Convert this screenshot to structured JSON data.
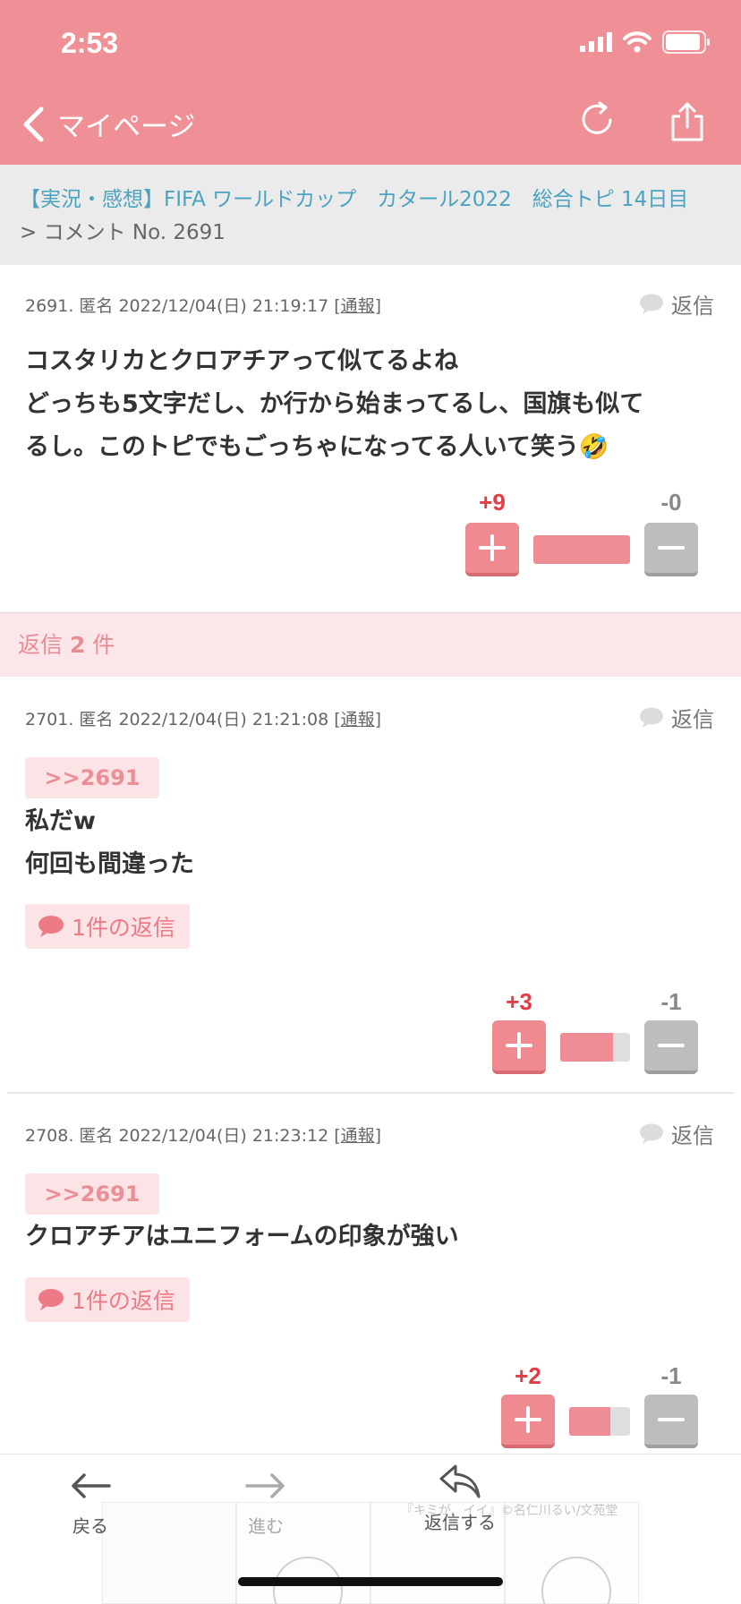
{
  "status_bar": {
    "time": "2:53"
  },
  "header": {
    "back_label": "マイページ"
  },
  "breadcrumb": {
    "topic": "【実況・感想】FIFA ワールドカップ　カタール2022　総合トピ 14日目",
    "comment": "> コメント No. 2691"
  },
  "main_comment": {
    "meta_prefix": "2691. 匿名 2022/12/04(日) 21:19:17 [",
    "report": "通報",
    "meta_suffix": "]",
    "reply_label": "返信",
    "lines": [
      "コスタリカとクロアチアって似てるよね",
      "どっちも5文字だし、か行から始まってるし、国旗も似て",
      "るし。このトピでもごっちゃになってる人いて笑う🤣"
    ],
    "plus": "+9",
    "minus": "-0",
    "ratio": 1.0
  },
  "replies_header": {
    "prefix": "返信 ",
    "count": "2",
    "suffix": " 件"
  },
  "replies": [
    {
      "meta_prefix": "2701. 匿名 2022/12/04(日) 21:21:08 [",
      "report": "通報",
      "meta_suffix": "]",
      "reply_label": "返信",
      "anchor": ">>2691",
      "lines": [
        "私だw",
        "何回も間違った"
      ],
      "reply_count": "1件の返信",
      "plus": "+3",
      "minus": "-1",
      "ratio": 0.75
    },
    {
      "meta_prefix": "2708. 匿名 2022/12/04(日) 21:23:12 [",
      "report": "通報",
      "meta_suffix": "]",
      "reply_label": "返信",
      "anchor": ">>2691",
      "lines": [
        "クロアチアはユニフォームの印象が強い"
      ],
      "reply_count": "1件の返信",
      "plus": "+2",
      "minus": "-1",
      "ratio": 0.67
    }
  ],
  "toolbar": {
    "back": "戻る",
    "forward": "進む",
    "reply": "返信する"
  },
  "ad": {
    "text": "『キミが、イイ』©名仁川るい/文苑堂"
  },
  "colors": {
    "header": "#ef9096",
    "accent": "#e23c44",
    "link": "#4aa3c0"
  }
}
